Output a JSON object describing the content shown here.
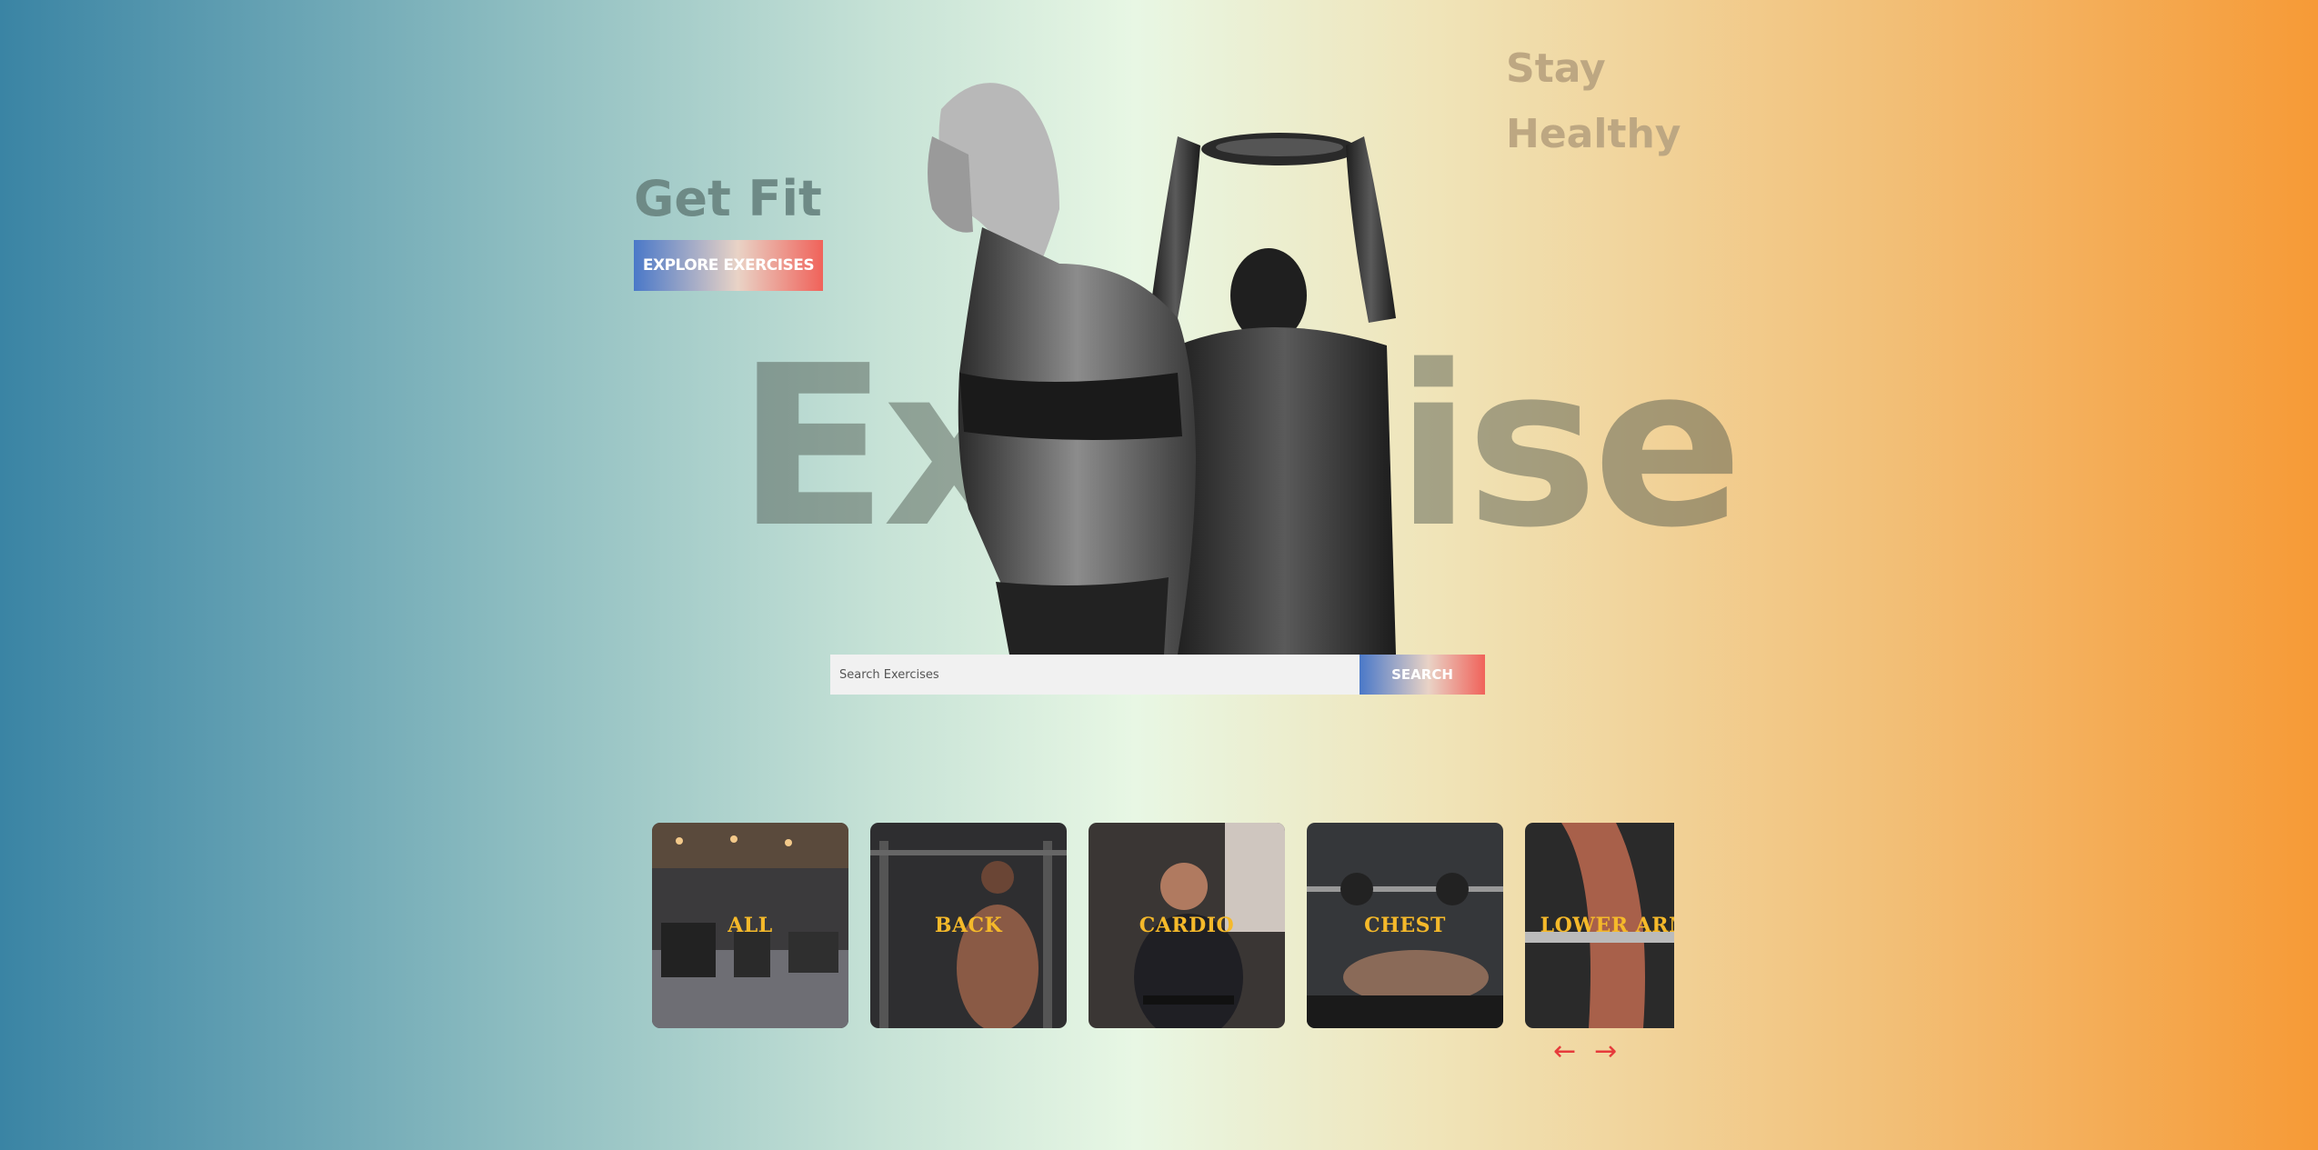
{
  "hero": {
    "get_fit": "Get Fit",
    "explore_button": "EXPLORE EXERCISES",
    "stay_healthy": "Stay Healthy",
    "background_word": "Exercise"
  },
  "search": {
    "placeholder": "Search Exercises",
    "button_label": "SEARCH"
  },
  "categories": [
    {
      "label": "ALL"
    },
    {
      "label": "BACK"
    },
    {
      "label": "CARDIO"
    },
    {
      "label": "CHEST"
    },
    {
      "label": "LOWER ARMS"
    }
  ],
  "carousel_nav": {
    "prev_icon": "arrow-left-icon",
    "next_icon": "arrow-right-icon",
    "prev": "←",
    "next": "→"
  },
  "colors": {
    "accent_red": "#e63b3b",
    "label_gold": "#f5b92a",
    "button_gradient_start": "#4a78c8",
    "button_gradient_end": "#f0625a"
  }
}
